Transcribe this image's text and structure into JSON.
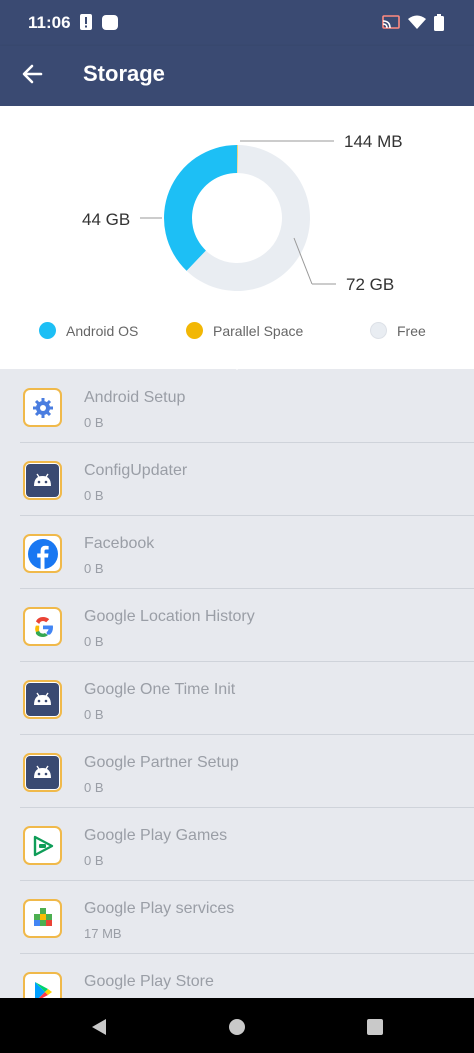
{
  "status_bar": {
    "time": "11:06",
    "left_icons": [
      "alert-icon",
      "notification-icon"
    ],
    "right_icons": [
      "cast-icon",
      "wifi-icon",
      "battery-icon"
    ]
  },
  "app_bar": {
    "title": "Storage",
    "back_icon": "arrow-back-icon"
  },
  "chart_data": {
    "type": "pie",
    "style": "donut",
    "labels": [
      "Android OS",
      "Parallel Space",
      "Free"
    ],
    "values": [
      44,
      0.144,
      72
    ],
    "value_labels": [
      "44 GB",
      "144 MB",
      "72 GB"
    ],
    "colors": [
      "#1dbff5",
      "#f2b705",
      "#e9edf2"
    ],
    "legend_position": "bottom"
  },
  "legend": [
    {
      "label": "Android OS",
      "color": "#1dbff5"
    },
    {
      "label": "Parallel Space",
      "color": "#f2b705"
    },
    {
      "label": "Free",
      "color": "#e9edf2"
    }
  ],
  "apps": [
    {
      "name": "Android Setup",
      "size": "0 B",
      "icon": "gear-icon"
    },
    {
      "name": "ConfigUpdater",
      "size": "0 B",
      "icon": "android-icon"
    },
    {
      "name": "Facebook",
      "size": "0 B",
      "icon": "facebook-icon"
    },
    {
      "name": "Google Location History",
      "size": "0 B",
      "icon": "google-icon"
    },
    {
      "name": "Google One Time Init",
      "size": "0 B",
      "icon": "android-icon"
    },
    {
      "name": "Google Partner Setup",
      "size": "0 B",
      "icon": "android-icon"
    },
    {
      "name": "Google Play Games",
      "size": "0 B",
      "icon": "play-games-icon"
    },
    {
      "name": "Google Play services",
      "size": "17 MB",
      "icon": "play-services-icon"
    },
    {
      "name": "Google Play Store",
      "size": "",
      "icon": "play-store-icon"
    }
  ],
  "nav_bar": [
    "back-nav-icon",
    "home-nav-icon",
    "recents-nav-icon"
  ]
}
